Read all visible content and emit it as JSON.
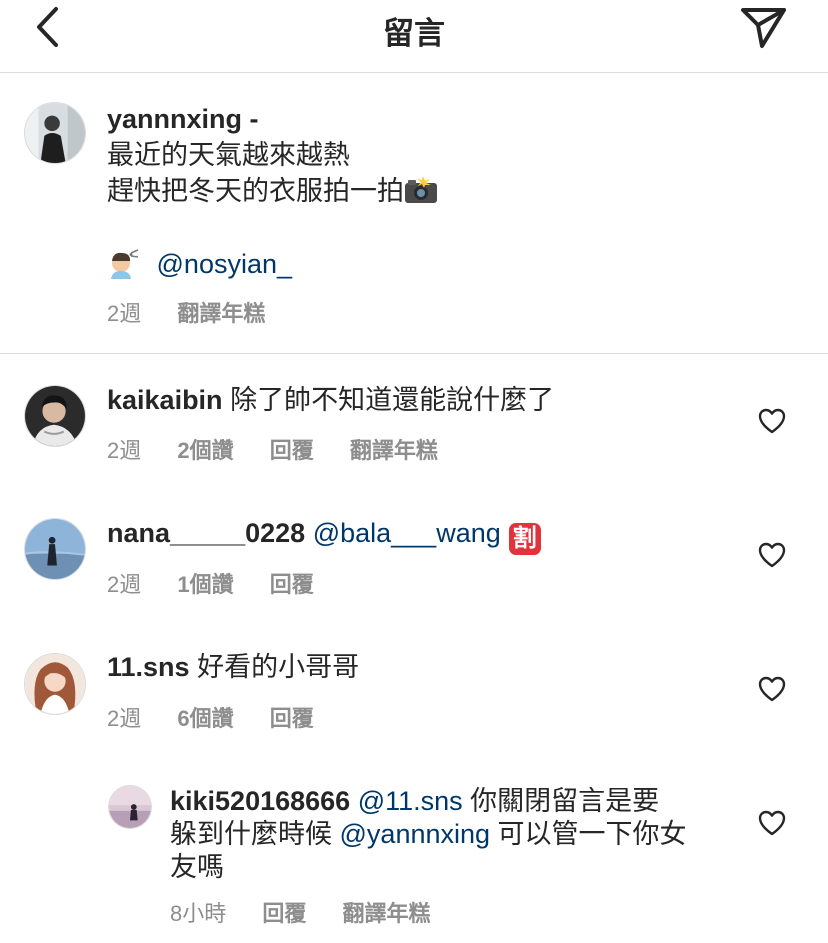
{
  "header": {
    "title": "留言"
  },
  "caption": {
    "username": "yannnxing -",
    "line1": "最近的天氣越來越熱",
    "line2": "趕快把冬天的衣服拍一拍",
    "credit_mention": "@nosyian_",
    "time": "2週",
    "translate": "翻譯年糕"
  },
  "comments": [
    {
      "username": "kaikaibin",
      "text": " 除了帥不知道還能說什麼了",
      "time": "2週",
      "likes": "2個讚",
      "reply": "回覆",
      "translate": "翻譯年糕"
    },
    {
      "username": "nana_____0228",
      "mention": "@bala___wang",
      "badge": "割",
      "time": "2週",
      "likes": "1個讚",
      "reply": "回覆"
    },
    {
      "username": "11.sns",
      "text": " 好看的小哥哥",
      "time": "2週",
      "likes": "6個讚",
      "reply": "回覆"
    }
  ],
  "reply": {
    "username": "kiki520168666",
    "mention1": "@11.sns",
    "text1": " 你關閉留言是要",
    "text2a": "躲到什麼時候 ",
    "mention2": "@yannnxing",
    "text2b": " 可以管一下你女",
    "text3": "友嗎",
    "time": "8小時",
    "reply": "回覆",
    "translate": "翻譯年糕"
  },
  "icons": {
    "back": "chevron-left-icon",
    "share": "paper-plane-icon",
    "like": "heart-outline-icon"
  },
  "colors": {
    "text": "#262626",
    "secondary": "#8e8e8e",
    "mention": "#00376b",
    "divider": "#dbdbdb",
    "badge": "#e0333c"
  }
}
